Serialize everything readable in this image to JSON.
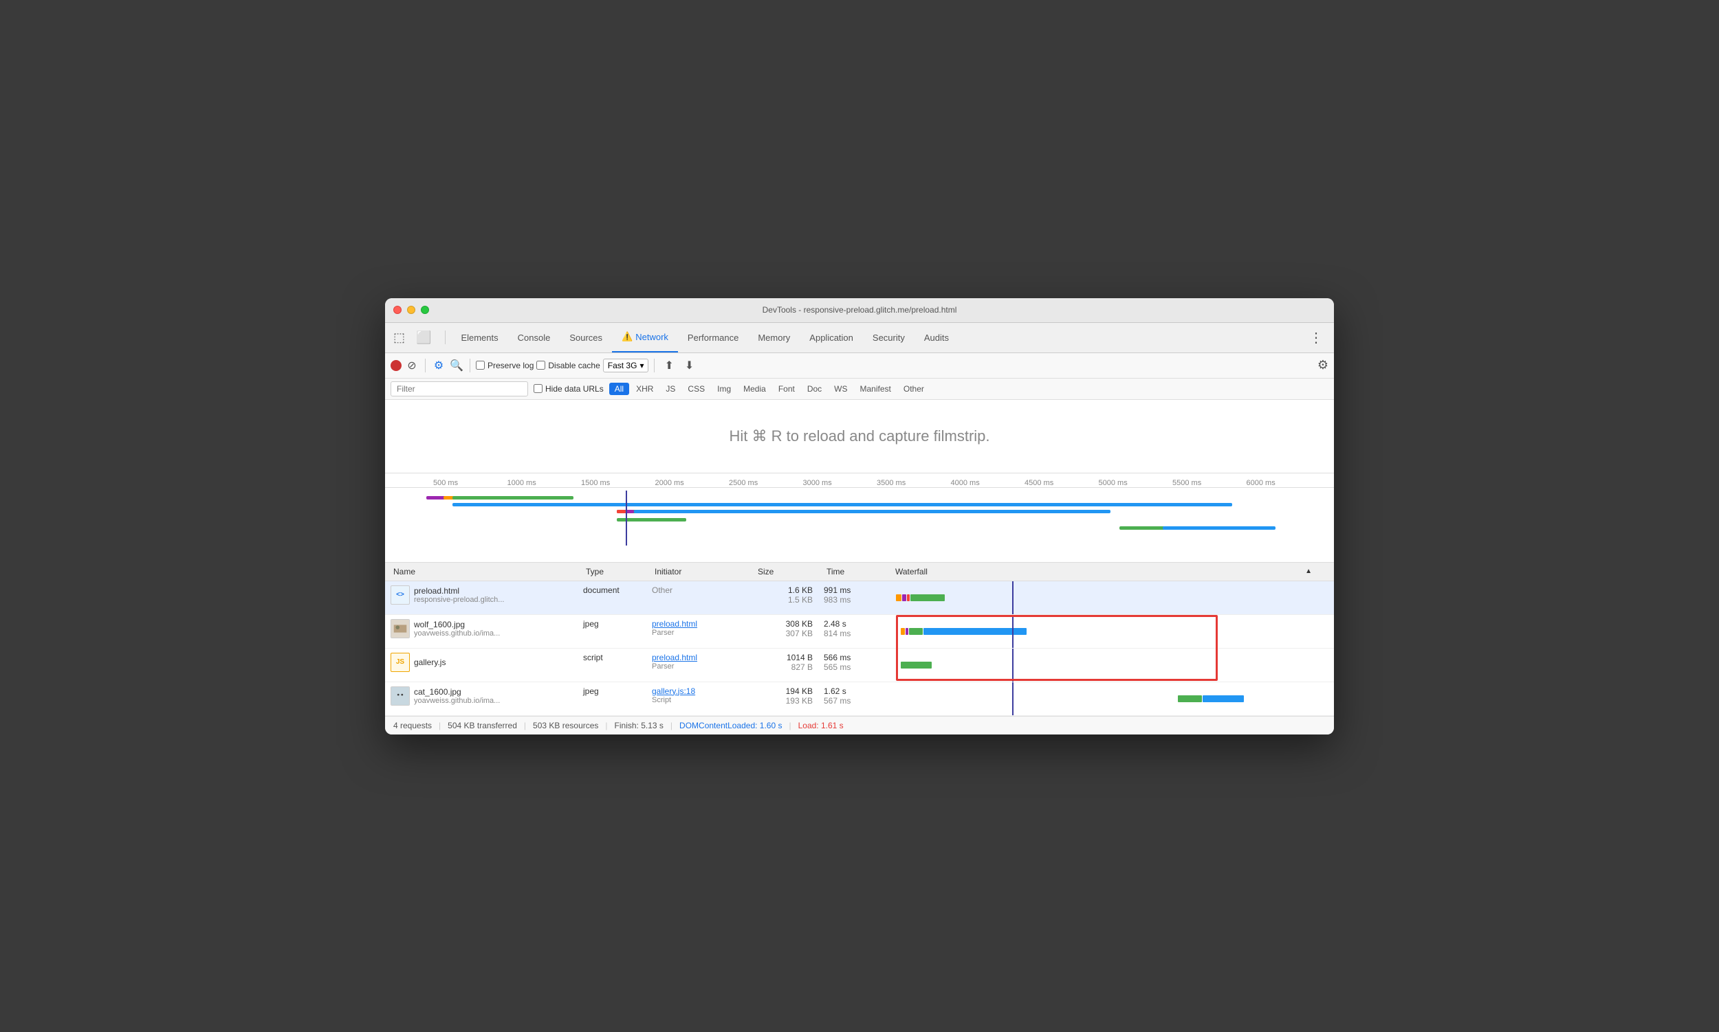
{
  "window": {
    "title": "DevTools - responsive-preload.glitch.me/preload.html"
  },
  "tabs": {
    "items": [
      {
        "label": "Elements",
        "active": false
      },
      {
        "label": "Console",
        "active": false
      },
      {
        "label": "Sources",
        "active": false
      },
      {
        "label": "Network",
        "active": true,
        "warning": true
      },
      {
        "label": "Performance",
        "active": false
      },
      {
        "label": "Memory",
        "active": false
      },
      {
        "label": "Application",
        "active": false
      },
      {
        "label": "Security",
        "active": false
      },
      {
        "label": "Audits",
        "active": false
      }
    ]
  },
  "toolbar": {
    "preserve_log_label": "Preserve log",
    "disable_cache_label": "Disable cache",
    "network_throttle": "Fast 3G"
  },
  "filter": {
    "placeholder": "Filter",
    "hide_data_urls_label": "Hide data URLs",
    "types": [
      "All",
      "XHR",
      "JS",
      "CSS",
      "Img",
      "Media",
      "Font",
      "Doc",
      "WS",
      "Manifest",
      "Other"
    ]
  },
  "filmstrip": {
    "message": "Hit ⌘ R to reload and capture filmstrip."
  },
  "timeline": {
    "markers": [
      "500 ms",
      "1000 ms",
      "1500 ms",
      "2000 ms",
      "2500 ms",
      "3000 ms",
      "3500 ms",
      "4000 ms",
      "4500 ms",
      "5000 ms",
      "5500 ms",
      "6000 ms"
    ]
  },
  "table": {
    "headers": [
      "Name",
      "Type",
      "Initiator",
      "Size",
      "Time",
      "Waterfall"
    ],
    "rows": [
      {
        "icon_type": "html",
        "icon_text": "<>",
        "name": "preload.html",
        "name_sub": "responsive-preload.glitch...",
        "type": "document",
        "initiator": "Other",
        "initiator_link": false,
        "size1": "1.6 KB",
        "size2": "1.5 KB",
        "time1": "991 ms",
        "time2": "983 ms",
        "selected": true
      },
      {
        "icon_type": "jpg",
        "icon_text": "🖼",
        "name": "wolf_1600.jpg",
        "name_sub": "yoavweiss.github.io/ima...",
        "type": "jpeg",
        "initiator": "preload.html",
        "initiator_link": true,
        "initiator_sub": "Parser",
        "size1": "308 KB",
        "size2": "307 KB",
        "time1": "2.48 s",
        "time2": "814 ms",
        "selected": false
      },
      {
        "icon_type": "js",
        "icon_text": "JS",
        "name": "gallery.js",
        "name_sub": "",
        "type": "script",
        "initiator": "preload.html",
        "initiator_link": true,
        "initiator_sub": "Parser",
        "size1": "1014 B",
        "size2": "827 B",
        "time1": "566 ms",
        "time2": "565 ms",
        "selected": false
      },
      {
        "icon_type": "jpg",
        "icon_text": "🖼",
        "name": "cat_1600.jpg",
        "name_sub": "yoavweiss.github.io/ima...",
        "type": "jpeg",
        "initiator": "gallery.js:18",
        "initiator_link": true,
        "initiator_sub": "Script",
        "size1": "194 KB",
        "size2": "193 KB",
        "time1": "1.62 s",
        "time2": "567 ms",
        "selected": false
      }
    ]
  },
  "status": {
    "requests": "4 requests",
    "transferred": "504 KB transferred",
    "resources": "503 KB resources",
    "finish": "Finish: 5.13 s",
    "dom_content_loaded": "DOMContentLoaded: 1.60 s",
    "load": "Load: 1.61 s"
  }
}
